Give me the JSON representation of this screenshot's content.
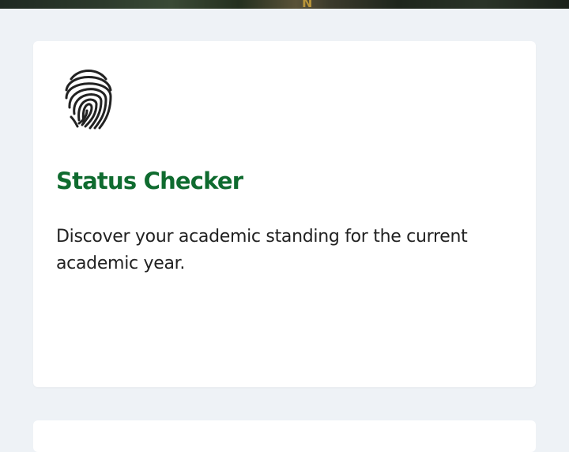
{
  "card": {
    "icon": "fingerprint-icon",
    "title": "Status Checker",
    "description": "Discover your academic standing for the current academic year."
  },
  "colors": {
    "title": "#0f6b2f",
    "page_background": "#eef2f6",
    "card_background": "#ffffff"
  }
}
